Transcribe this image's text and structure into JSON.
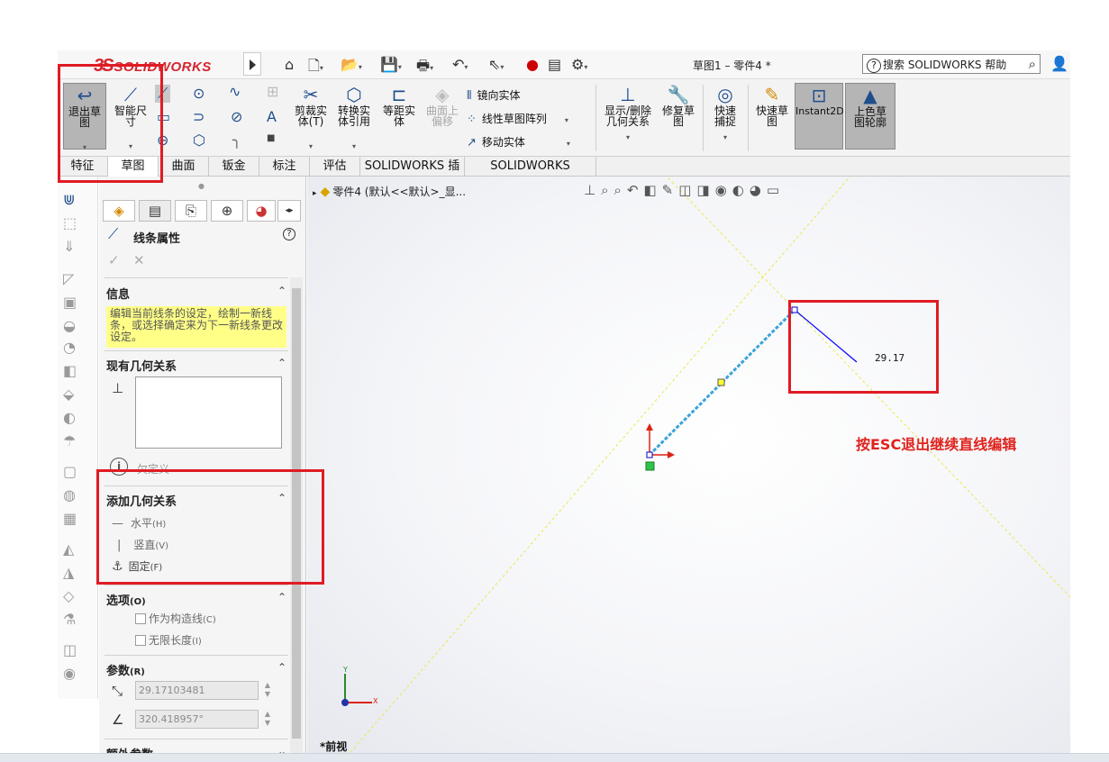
{
  "topbar": {
    "brand": "SOLIDWORKS",
    "brand_prefix": "3S",
    "doc_title": "草图1 – 零件4 *",
    "search_placeholder": "搜索 SOLIDWORKS 帮助",
    "icons": [
      "home-icon",
      "new-icon",
      "open-icon",
      "save-icon",
      "print-icon",
      "undo-icon",
      "select-icon",
      "rebuild-icon",
      "file-properties-icon",
      "options-icon"
    ]
  },
  "ribbon": {
    "exit_sketch": "退出草图",
    "smart_dimension": "智能尺寸",
    "trim_entities": "剪裁实体(T)",
    "convert_entities": "转换实体引用",
    "offset_entities": "等距实体",
    "offset_surface": "曲面上偏移",
    "mirror_entities": "镜向实体",
    "linear_pattern": "线性草图阵列",
    "move_entities": "移动实体",
    "display_relations": "显示/删除几何关系",
    "repair_sketch": "修复草图",
    "quick_snaps": "快速捕捉",
    "rapid_sketch": "快速草图",
    "instant2d": "Instant2D",
    "shaded_contours": "上色草图轮廓"
  },
  "tabs": [
    "特征",
    "草图",
    "曲面",
    "钣金",
    "标注",
    "评估",
    "SOLIDWORKS 插件",
    "SOLIDWORKS Inspection"
  ],
  "active_tab": "草图",
  "property_manager": {
    "title": "线条属性",
    "ok": "✓",
    "cancel": "✕",
    "info": {
      "header": "信息",
      "text": "编辑当前线条的设定，绘制一新线条，或选择确定来为下一新线条更改设定。"
    },
    "existing_relations": {
      "header": "现有几何关系",
      "status": "欠定义"
    },
    "add_relations": {
      "header": "添加几何关系",
      "horizontal": "水平",
      "horizontal_key": "(H)",
      "vertical": "竖直",
      "vertical_key": "(V)",
      "fix": "固定",
      "fix_key": "(F)"
    },
    "options": {
      "header": "选项",
      "header_key": "(O)",
      "construction": "作为构造线",
      "construction_key": "(C)",
      "infinite": "无限长度",
      "infinite_key": "(I)"
    },
    "parameters": {
      "header": "参数",
      "header_key": "(R)",
      "length": "29.17103481",
      "angle": "320.418957°"
    },
    "extra": {
      "header": "额外参数"
    }
  },
  "graphics": {
    "tree_label": "零件4  (默认<<默认>_显...",
    "dimension_value": "29.17",
    "hint": "按ESC退出继续直线编辑",
    "view_label": "*前视",
    "axis_x": "X",
    "axis_y": "Y"
  },
  "colors": {
    "accent_red": "#e01b24",
    "sketch_blue": "#0000ff",
    "info_yellow": "#ffff88"
  }
}
